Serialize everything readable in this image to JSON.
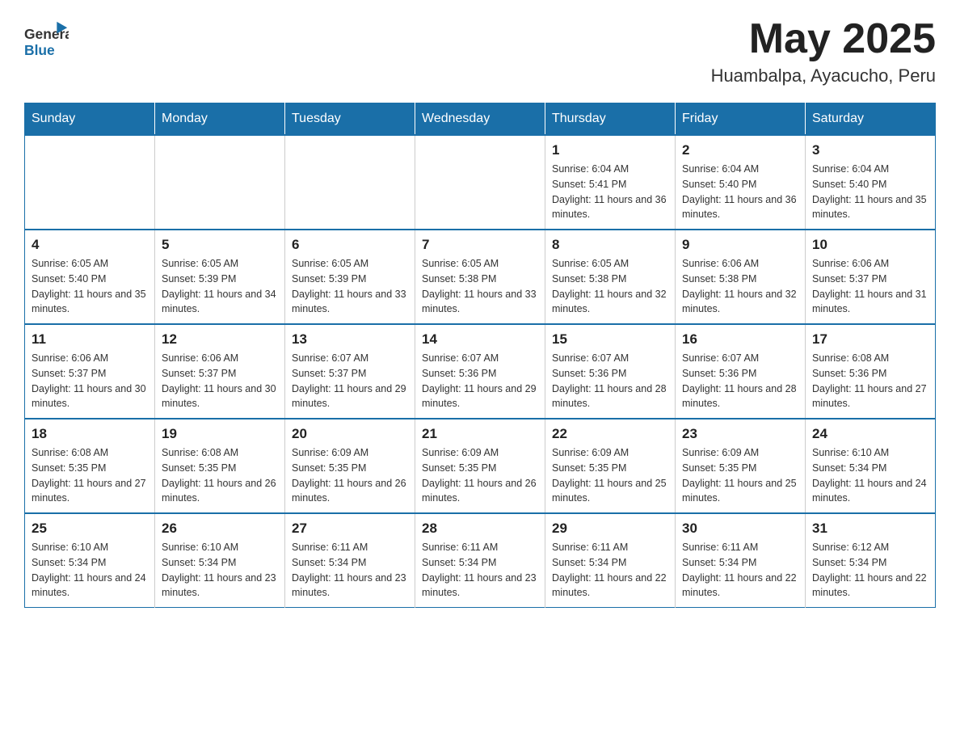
{
  "header": {
    "logo_general": "General",
    "logo_blue": "Blue",
    "month_year": "May 2025",
    "location": "Huambalpa, Ayacucho, Peru"
  },
  "days_of_week": [
    "Sunday",
    "Monday",
    "Tuesday",
    "Wednesday",
    "Thursday",
    "Friday",
    "Saturday"
  ],
  "weeks": [
    {
      "cells": [
        {
          "empty": true
        },
        {
          "empty": true
        },
        {
          "empty": true
        },
        {
          "empty": true
        },
        {
          "day": 1,
          "sunrise": "6:04 AM",
          "sunset": "5:41 PM",
          "daylight": "11 hours and 36 minutes."
        },
        {
          "day": 2,
          "sunrise": "6:04 AM",
          "sunset": "5:40 PM",
          "daylight": "11 hours and 36 minutes."
        },
        {
          "day": 3,
          "sunrise": "6:04 AM",
          "sunset": "5:40 PM",
          "daylight": "11 hours and 35 minutes."
        }
      ]
    },
    {
      "cells": [
        {
          "day": 4,
          "sunrise": "6:05 AM",
          "sunset": "5:40 PM",
          "daylight": "11 hours and 35 minutes."
        },
        {
          "day": 5,
          "sunrise": "6:05 AM",
          "sunset": "5:39 PM",
          "daylight": "11 hours and 34 minutes."
        },
        {
          "day": 6,
          "sunrise": "6:05 AM",
          "sunset": "5:39 PM",
          "daylight": "11 hours and 33 minutes."
        },
        {
          "day": 7,
          "sunrise": "6:05 AM",
          "sunset": "5:38 PM",
          "daylight": "11 hours and 33 minutes."
        },
        {
          "day": 8,
          "sunrise": "6:05 AM",
          "sunset": "5:38 PM",
          "daylight": "11 hours and 32 minutes."
        },
        {
          "day": 9,
          "sunrise": "6:06 AM",
          "sunset": "5:38 PM",
          "daylight": "11 hours and 32 minutes."
        },
        {
          "day": 10,
          "sunrise": "6:06 AM",
          "sunset": "5:37 PM",
          "daylight": "11 hours and 31 minutes."
        }
      ]
    },
    {
      "cells": [
        {
          "day": 11,
          "sunrise": "6:06 AM",
          "sunset": "5:37 PM",
          "daylight": "11 hours and 30 minutes."
        },
        {
          "day": 12,
          "sunrise": "6:06 AM",
          "sunset": "5:37 PM",
          "daylight": "11 hours and 30 minutes."
        },
        {
          "day": 13,
          "sunrise": "6:07 AM",
          "sunset": "5:37 PM",
          "daylight": "11 hours and 29 minutes."
        },
        {
          "day": 14,
          "sunrise": "6:07 AM",
          "sunset": "5:36 PM",
          "daylight": "11 hours and 29 minutes."
        },
        {
          "day": 15,
          "sunrise": "6:07 AM",
          "sunset": "5:36 PM",
          "daylight": "11 hours and 28 minutes."
        },
        {
          "day": 16,
          "sunrise": "6:07 AM",
          "sunset": "5:36 PM",
          "daylight": "11 hours and 28 minutes."
        },
        {
          "day": 17,
          "sunrise": "6:08 AM",
          "sunset": "5:36 PM",
          "daylight": "11 hours and 27 minutes."
        }
      ]
    },
    {
      "cells": [
        {
          "day": 18,
          "sunrise": "6:08 AM",
          "sunset": "5:35 PM",
          "daylight": "11 hours and 27 minutes."
        },
        {
          "day": 19,
          "sunrise": "6:08 AM",
          "sunset": "5:35 PM",
          "daylight": "11 hours and 26 minutes."
        },
        {
          "day": 20,
          "sunrise": "6:09 AM",
          "sunset": "5:35 PM",
          "daylight": "11 hours and 26 minutes."
        },
        {
          "day": 21,
          "sunrise": "6:09 AM",
          "sunset": "5:35 PM",
          "daylight": "11 hours and 26 minutes."
        },
        {
          "day": 22,
          "sunrise": "6:09 AM",
          "sunset": "5:35 PM",
          "daylight": "11 hours and 25 minutes."
        },
        {
          "day": 23,
          "sunrise": "6:09 AM",
          "sunset": "5:35 PM",
          "daylight": "11 hours and 25 minutes."
        },
        {
          "day": 24,
          "sunrise": "6:10 AM",
          "sunset": "5:34 PM",
          "daylight": "11 hours and 24 minutes."
        }
      ]
    },
    {
      "cells": [
        {
          "day": 25,
          "sunrise": "6:10 AM",
          "sunset": "5:34 PM",
          "daylight": "11 hours and 24 minutes."
        },
        {
          "day": 26,
          "sunrise": "6:10 AM",
          "sunset": "5:34 PM",
          "daylight": "11 hours and 23 minutes."
        },
        {
          "day": 27,
          "sunrise": "6:11 AM",
          "sunset": "5:34 PM",
          "daylight": "11 hours and 23 minutes."
        },
        {
          "day": 28,
          "sunrise": "6:11 AM",
          "sunset": "5:34 PM",
          "daylight": "11 hours and 23 minutes."
        },
        {
          "day": 29,
          "sunrise": "6:11 AM",
          "sunset": "5:34 PM",
          "daylight": "11 hours and 22 minutes."
        },
        {
          "day": 30,
          "sunrise": "6:11 AM",
          "sunset": "5:34 PM",
          "daylight": "11 hours and 22 minutes."
        },
        {
          "day": 31,
          "sunrise": "6:12 AM",
          "sunset": "5:34 PM",
          "daylight": "11 hours and 22 minutes."
        }
      ]
    }
  ],
  "labels": {
    "sunrise": "Sunrise:",
    "sunset": "Sunset:",
    "daylight": "Daylight:"
  }
}
